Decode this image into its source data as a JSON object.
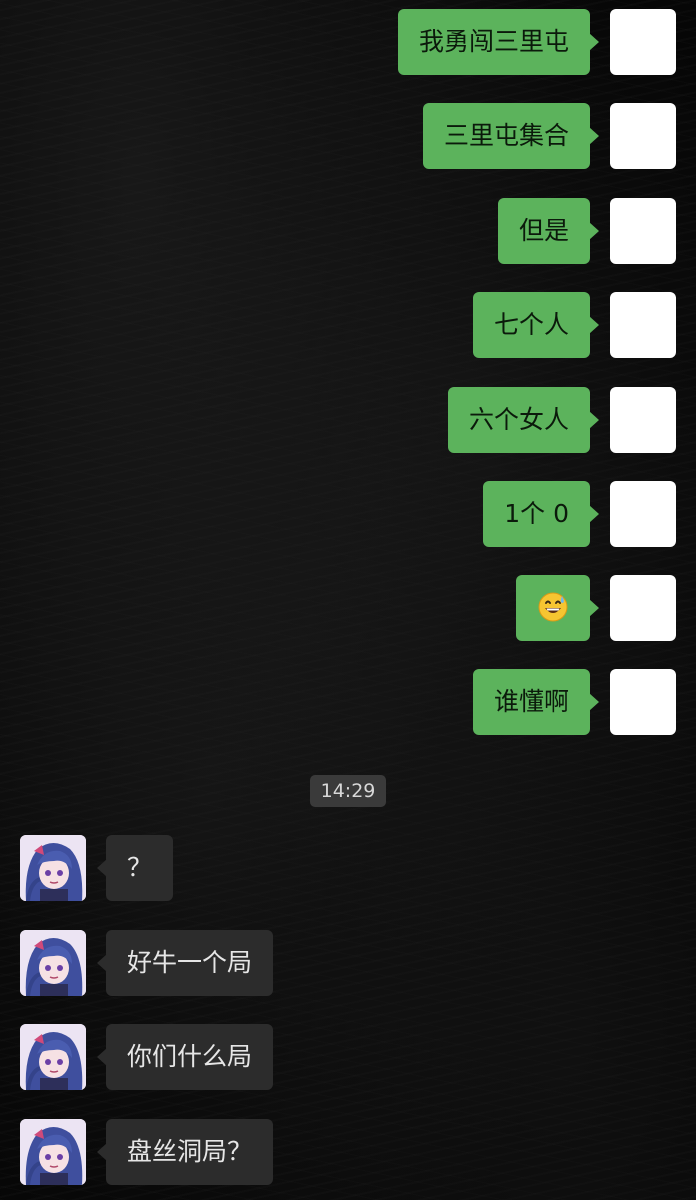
{
  "outgoing_messages": [
    {
      "text": "我勇闯三里屯"
    },
    {
      "text": "三里屯集合"
    },
    {
      "text": "但是"
    },
    {
      "text": "七个人"
    },
    {
      "text": "六个女人"
    },
    {
      "text": "1个 0"
    },
    {
      "emoji": "grinning-face-with-sweat"
    },
    {
      "text": "谁懂啊"
    }
  ],
  "timestamp": "14:29",
  "incoming_messages": [
    {
      "text": "？"
    },
    {
      "text": "好牛一个局"
    },
    {
      "text": "你们什么局"
    },
    {
      "text": "盘丝洞局？"
    }
  ],
  "colors": {
    "outgoing_bubble": "#5cb35c",
    "incoming_bubble": "#2c2c2c",
    "background": "#050505",
    "self_avatar": "#ffffff",
    "timestamp_bg": "#3a3a3a"
  },
  "icons": {
    "self_avatar": "blank-white-avatar",
    "other_avatar": "anime-girl-blue-hair-avatar"
  }
}
